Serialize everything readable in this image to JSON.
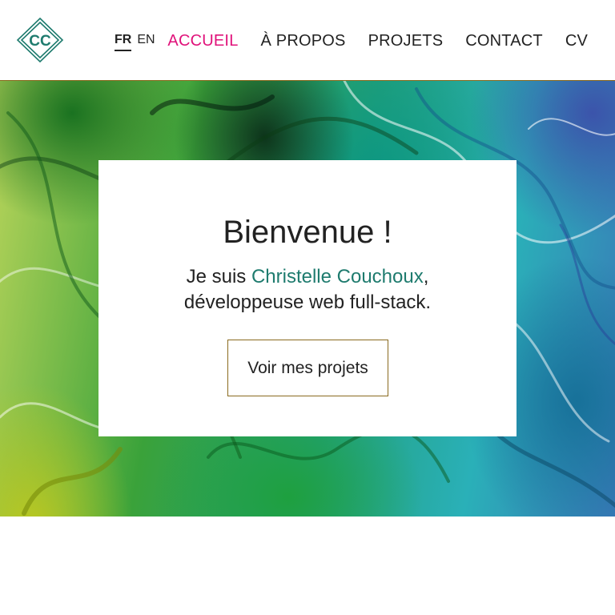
{
  "header": {
    "logo_text": "CC",
    "languages": [
      {
        "label": "FR",
        "active": true
      },
      {
        "label": "EN",
        "active": false
      }
    ],
    "nav": [
      {
        "label": "ACCUEIL",
        "active": true
      },
      {
        "label": "À PROPOS",
        "active": false
      },
      {
        "label": "PROJETS",
        "active": false
      },
      {
        "label": "CONTACT",
        "active": false
      },
      {
        "label": "CV",
        "active": false
      }
    ]
  },
  "hero": {
    "title": "Bienvenue !",
    "intro_prefix": "Je suis ",
    "name": "Christelle Couchoux",
    "intro_suffix": ",",
    "role": "développeuse web full-stack.",
    "cta_label": "Voir mes projets"
  },
  "colors": {
    "accent_nav": "#e0127a",
    "name_teal": "#1e7b6e",
    "logo_teal": "#1e7b6e",
    "border_gold": "#8a6a1f"
  }
}
